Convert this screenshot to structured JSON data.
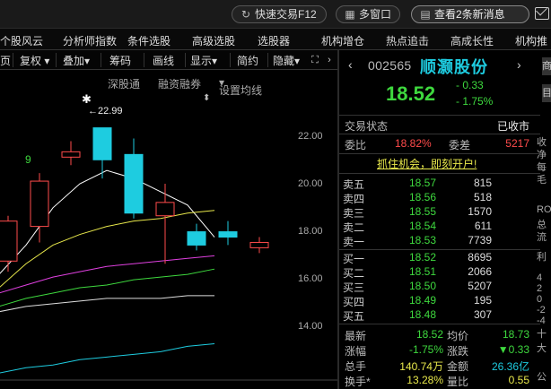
{
  "topbar": {
    "quick_trade": "快速交易F12",
    "multi_window": "多窗口",
    "news": "查看2条新消息"
  },
  "menu": {
    "items": [
      "个股风云",
      "分析师指数",
      "条件选股",
      "高级选股",
      "选股器",
      "机构增仓",
      "热点追击",
      "高成长性",
      "机构推"
    ]
  },
  "chart_toolbar": {
    "items": [
      "页",
      "复权",
      "叠加",
      "筹码",
      "画线",
      "显示",
      "简约",
      "隐藏"
    ]
  },
  "chart_sub": {
    "market": "深股通",
    "margin": "融资融券",
    "ma_setting": "设置均线"
  },
  "chart_data": {
    "type": "candlestick",
    "y_ticks": [
      "22.00",
      "20.00",
      "18.00",
      "16.00",
      "14.00"
    ],
    "ylim": [
      13.2,
      24.5
    ],
    "annotations": {
      "high_label": "22.99",
      "count_label": "9"
    },
    "candles": [
      {
        "open": 18.0,
        "close": 19.5,
        "high": 19.7,
        "low": 17.6,
        "up": true
      },
      {
        "open": 19.3,
        "close": 21.0,
        "high": 21.3,
        "low": 18.7,
        "up": true
      },
      {
        "open": 21.9,
        "close": 22.1,
        "high": 22.5,
        "low": 21.6,
        "up": true
      },
      {
        "open": 21.8,
        "close": 23.0,
        "high": 23.0,
        "low": 21.1,
        "up": false,
        "fill": "cyan"
      },
      {
        "open": 22.0,
        "close": 19.8,
        "high": 22.6,
        "low": 19.6,
        "up": false,
        "fill": "cyan"
      },
      {
        "open": 20.2,
        "close": 19.7,
        "high": 20.9,
        "low": 17.9,
        "up": true
      },
      {
        "open": 19.1,
        "close": 18.6,
        "high": 19.4,
        "low": 18.4,
        "up": false,
        "fill": "cyan"
      },
      {
        "open": 19.1,
        "close": 18.9,
        "high": 19.5,
        "low": 18.6,
        "up": false,
        "fill": "cyan"
      },
      {
        "open": 18.5,
        "close": 18.7,
        "high": 18.9,
        "low": 18.3,
        "up": true
      }
    ],
    "ma_lines": [
      {
        "color": "#ffffff",
        "values": [
          17.5,
          18.6,
          20.0,
          20.9,
          21.4,
          21.1,
          20.6,
          20.1,
          18.9
        ]
      },
      {
        "color": "#e8e84b",
        "values": [
          17.0,
          17.9,
          18.6,
          19.0,
          19.3,
          19.5,
          19.6,
          19.8,
          19.9
        ]
      },
      {
        "color": "#e040e0",
        "values": [
          16.8,
          17.1,
          17.4,
          17.6,
          17.8,
          17.9,
          18.0,
          18.1,
          18.2
        ]
      },
      {
        "color": "#3ed83e",
        "values": [
          16.3,
          16.6,
          16.8,
          17.0,
          17.1,
          17.3,
          17.4,
          17.5,
          17.7
        ]
      },
      {
        "color": "#dddddd",
        "values": [
          16.1,
          16.3,
          16.4,
          16.5,
          16.6,
          16.6,
          16.6,
          16.7,
          16.7
        ]
      },
      {
        "color": "#1ecce0",
        "values": [
          13.8,
          14.0,
          14.1,
          14.3,
          14.4,
          14.5,
          14.6,
          14.8,
          14.9
        ]
      }
    ]
  },
  "stock": {
    "code": "002565",
    "name": "顺灏股份",
    "price": "18.52",
    "change": "- 0.33",
    "change_pct": "- 1.75%"
  },
  "status": {
    "label": "交易状态",
    "value": "已收市"
  },
  "ratio": {
    "wb_label": "委比",
    "wb_value": "18.82%",
    "wc_label": "委差",
    "wc_value": "5217"
  },
  "promo": "抓住机会，即刻开户!",
  "asks": [
    {
      "label": "卖五",
      "price": "18.57",
      "vol": "815"
    },
    {
      "label": "卖四",
      "price": "18.56",
      "vol": "518"
    },
    {
      "label": "卖三",
      "price": "18.55",
      "vol": "1570"
    },
    {
      "label": "卖二",
      "price": "18.54",
      "vol": "611"
    },
    {
      "label": "卖一",
      "price": "18.53",
      "vol": "7739"
    }
  ],
  "bids": [
    {
      "label": "买一",
      "price": "18.52",
      "vol": "8695"
    },
    {
      "label": "买二",
      "price": "18.51",
      "vol": "2066"
    },
    {
      "label": "买三",
      "price": "18.50",
      "vol": "5207"
    },
    {
      "label": "买四",
      "price": "18.49",
      "vol": "195"
    },
    {
      "label": "买五",
      "price": "18.48",
      "vol": "307"
    }
  ],
  "stats": [
    {
      "k1": "最新",
      "v1": "18.52",
      "k2": "均价",
      "v2": "18.73"
    },
    {
      "k1": "涨幅",
      "v1": "-1.75%",
      "k2": "涨跌",
      "v2": "▼0.33"
    },
    {
      "k1": "总手",
      "v1": "140.74万",
      "k2": "金额",
      "v2": "26.36亿"
    },
    {
      "k1": "换手*",
      "v1": "13.28%",
      "k2": "量比",
      "v2": "0.55"
    }
  ],
  "side_labels": [
    "收",
    "净",
    "每",
    "毛",
    "RO",
    "总",
    "流",
    "利",
    "4",
    "2",
    "0",
    "-2",
    "-4",
    "十大",
    "公"
  ]
}
